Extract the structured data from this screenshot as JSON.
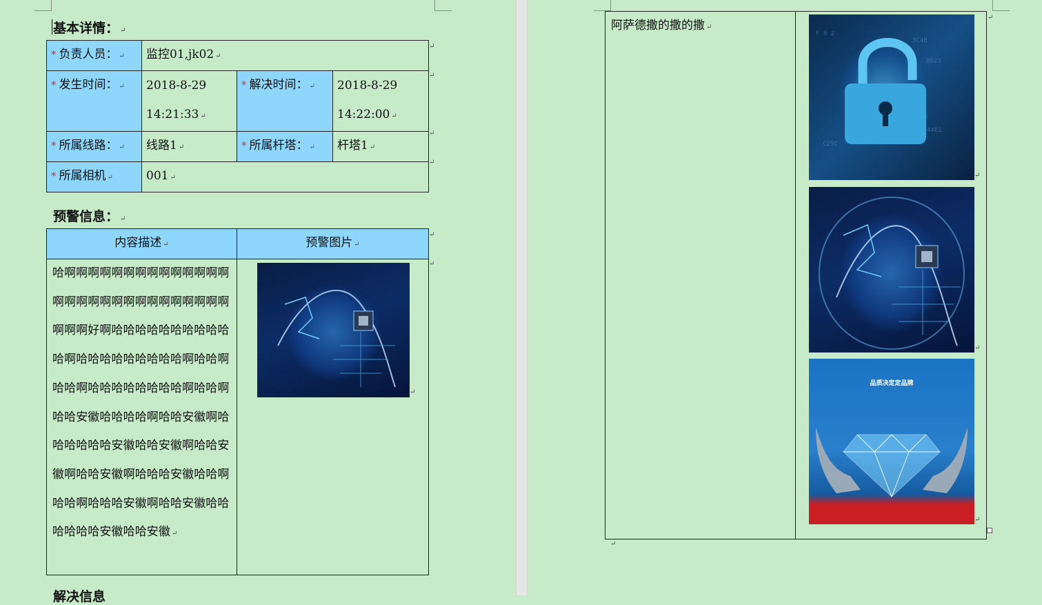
{
  "left_page": {
    "basic_heading": "基本详情：",
    "basic_info": {
      "responsible_label": "负责人员：",
      "responsible_value": "监控01,jk02",
      "occur_label": "发生时间：",
      "occur_date": "2018-8-29",
      "occur_time": "14:21:33",
      "resolve_label": "解决时间：",
      "resolve_date": "2018-8-29",
      "resolve_time": "14:22:00",
      "line_label": "所属线路：",
      "line_value": "线路1",
      "tower_label": "所属杆塔：",
      "tower_value": "杆塔1",
      "camera_label": "所属相机",
      "camera_value": "001"
    },
    "warning_heading": "预警信息：",
    "warning_table": {
      "col_desc": "内容描述",
      "col_image": "预警图片",
      "description": "哈啊啊啊啊啊啊啊啊啊啊啊啊啊啊啊啊啊啊啊啊啊啊啊啊啊啊啊啊啊啊啊啊好啊哈哈哈哈哈哈哈哈哈哈哈啊哈哈哈哈哈哈哈哈哈啊哈哈啊哈哈啊哈哈哈哈哈哈哈哈啊哈哈啊哈哈安徽哈哈哈哈啊哈哈安徽啊哈哈哈哈哈哈安徽哈哈安徽啊哈哈安徽啊哈哈安徽啊哈哈哈安徽哈哈啊哈哈啊哈哈哈安徽啊哈哈安徽哈哈哈哈哈哈安徽哈哈安徽"
    },
    "resolve_heading": "解决信息"
  },
  "right_page": {
    "cell_text": "阿萨德撒的撒的撒",
    "image_caption_text": "品质决定定品牌"
  },
  "marks": {
    "paragraph": "↵"
  }
}
